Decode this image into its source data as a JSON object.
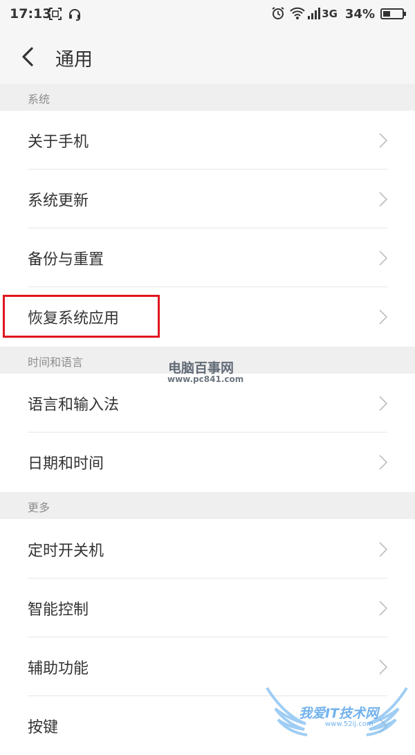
{
  "status_bar": {
    "time": "17:13",
    "network": "3G",
    "battery": "34%"
  },
  "header": {
    "title": "通用"
  },
  "sections": [
    {
      "title": "系统",
      "items": [
        "关于手机",
        "系统更新",
        "备份与重置",
        "恢复系统应用"
      ]
    },
    {
      "title": "时间和语言",
      "items": [
        "语言和输入法",
        "日期和时间"
      ]
    },
    {
      "title": "更多",
      "items": [
        "定时开关机",
        "智能控制",
        "辅助功能",
        "按键"
      ]
    }
  ],
  "watermarks": {
    "site1_name": "电脑百事网",
    "site1_url": "www.pc841.com",
    "site2_name": "我爱IT技术网",
    "site2_url": "www.52ij.com"
  },
  "colors": {
    "highlight_border": "#e0141e",
    "section_bg": "#efefef",
    "watermark_blue": "#5aa5ea"
  }
}
